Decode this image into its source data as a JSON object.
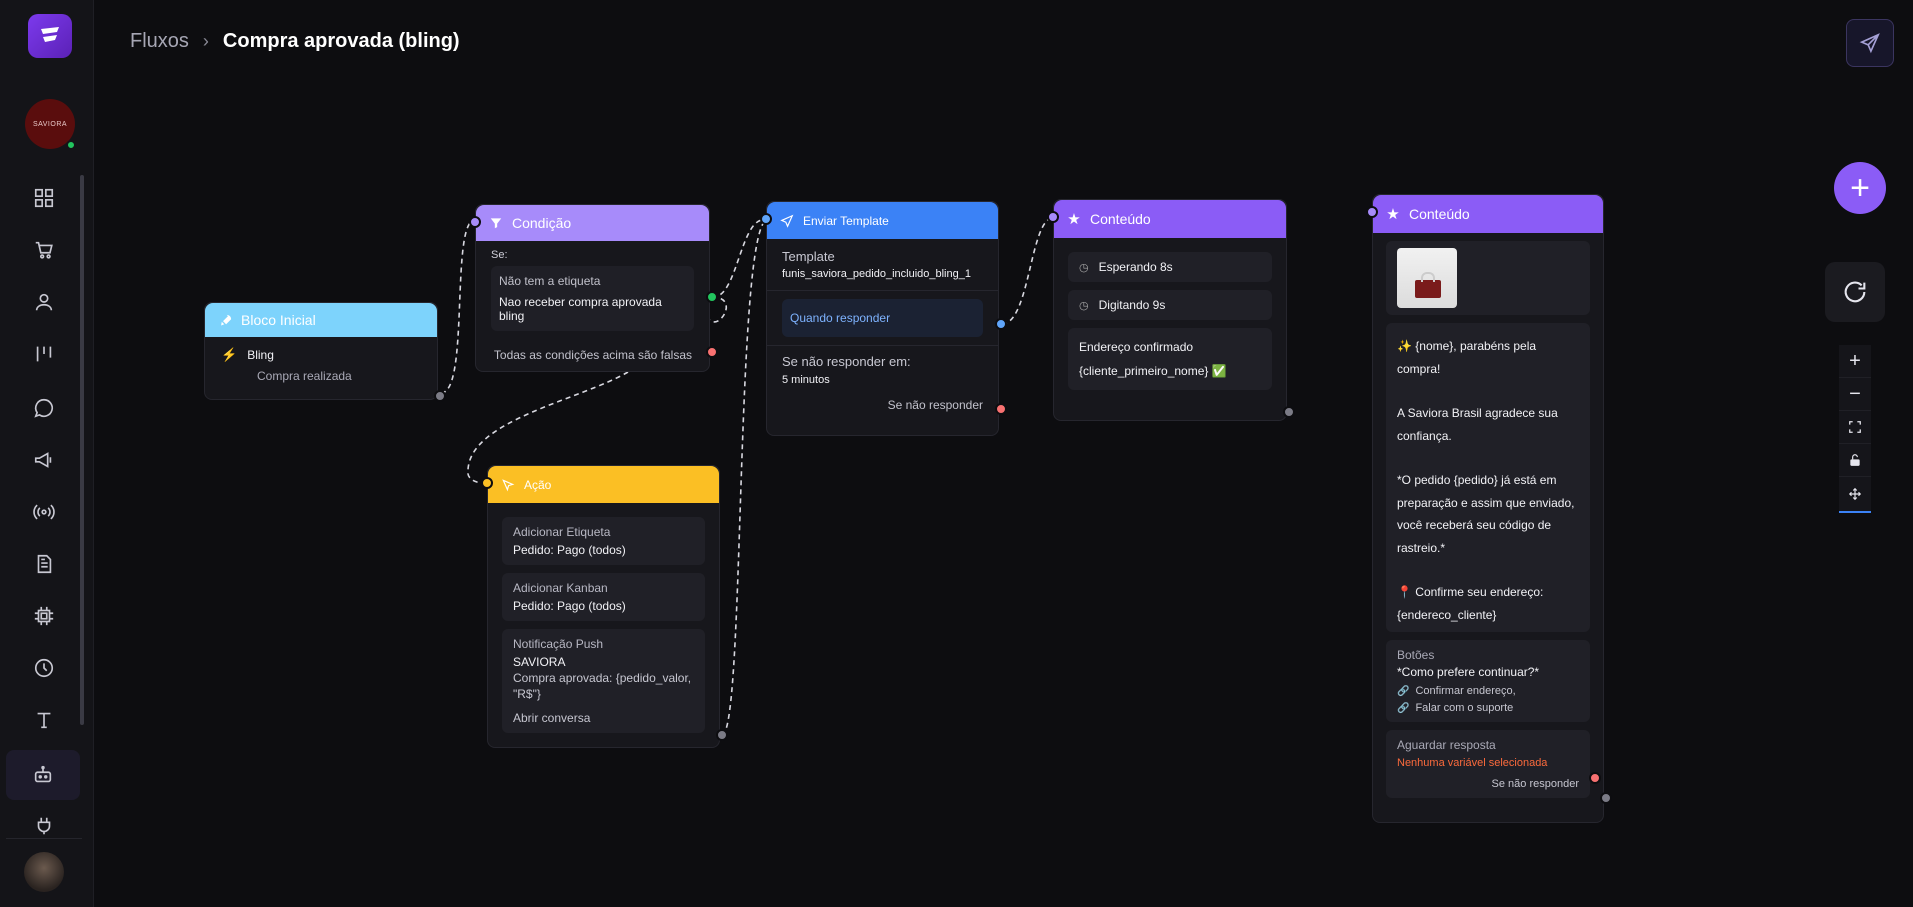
{
  "app": {
    "logo_icon": "flow-logo-icon",
    "brand_avatar_text": "SAVIORA"
  },
  "breadcrumb": {
    "parent": "Fluxos",
    "separator": ">",
    "current": "Compra aprovada (bling)"
  },
  "sidebar": {
    "items": [
      {
        "icon": "dashboard-icon"
      },
      {
        "icon": "cart-icon"
      },
      {
        "icon": "user-icon"
      },
      {
        "icon": "kanban-icon"
      },
      {
        "icon": "chat-icon"
      },
      {
        "icon": "megaphone-icon"
      },
      {
        "icon": "broadcast-icon"
      },
      {
        "icon": "document-icon"
      },
      {
        "icon": "chip-icon"
      },
      {
        "icon": "clock-icon"
      },
      {
        "icon": "text-icon"
      },
      {
        "icon": "bot-icon",
        "active": true
      },
      {
        "icon": "plug-icon"
      }
    ]
  },
  "nodes": {
    "start": {
      "title": "Bloco Inicial",
      "trigger": "Bling",
      "event": "Compra realizada"
    },
    "condition": {
      "title": "Condição",
      "if_label": "Se:",
      "rule_label": "Não tem a etiqueta",
      "rule_value": "Nao receber compra aprovada bling",
      "false_label": "Todas as condições acima são falsas"
    },
    "template": {
      "title": "Enviar Template",
      "template_label": "Template",
      "template_name": "funis_saviora_pedido_incluido_bling_1",
      "reply_label": "Quando responder",
      "timeout_label": "Se não responder em:",
      "timeout_value": "5 minutos",
      "no_reply_label": "Se não responder"
    },
    "content1": {
      "title": "Conteúdo",
      "wait": "Esperando 8s",
      "typing": "Digitando 9s",
      "msg_line1": "Endereço confirmado",
      "msg_line2": "{cliente_primeiro_nome} ✅"
    },
    "action": {
      "title": "Ação",
      "items": [
        {
          "label": "Adicionar Etiqueta",
          "value": "Pedido: Pago (todos)"
        },
        {
          "label": "Adicionar Kanban",
          "value": "Pedido: Pago (todos)"
        }
      ],
      "push": {
        "label": "Notificação Push",
        "title": "SAVIORA",
        "body1": "Compra aprovada: {pedido_valor,",
        "body2": "\"R$\"}",
        "action": "Abrir conversa"
      }
    },
    "content2": {
      "title": "Conteúdo",
      "message": [
        "✨ {nome}, parabéns pela compra!",
        "",
        "A Saviora Brasil agradece sua",
        "confiança.",
        "",
        "*O pedido {pedido} já está em",
        "preparação e assim que enviado,",
        "você receberá seu código de",
        "rastreio.*",
        "",
        "📍 Confirme seu endereço:",
        "{endereco_cliente}"
      ],
      "buttons_label": "Botões",
      "buttons_title": "*Como prefere continuar?*",
      "button1": "Confirmar endereço,",
      "button2": "Falar com o suporte",
      "await_label": "Aguardar resposta",
      "await_value": "Nenhuma variável selecionada",
      "no_reply_label": "Se não responder"
    }
  },
  "controls": {
    "zoom_in": "+",
    "zoom_out": "−"
  },
  "colors": {
    "start": "#7dd3fc",
    "condition": "#a78bfa",
    "template": "#3b82f6",
    "content": "#8b5cf6",
    "action": "#fbbf24",
    "accent": "#8b5cf6"
  }
}
